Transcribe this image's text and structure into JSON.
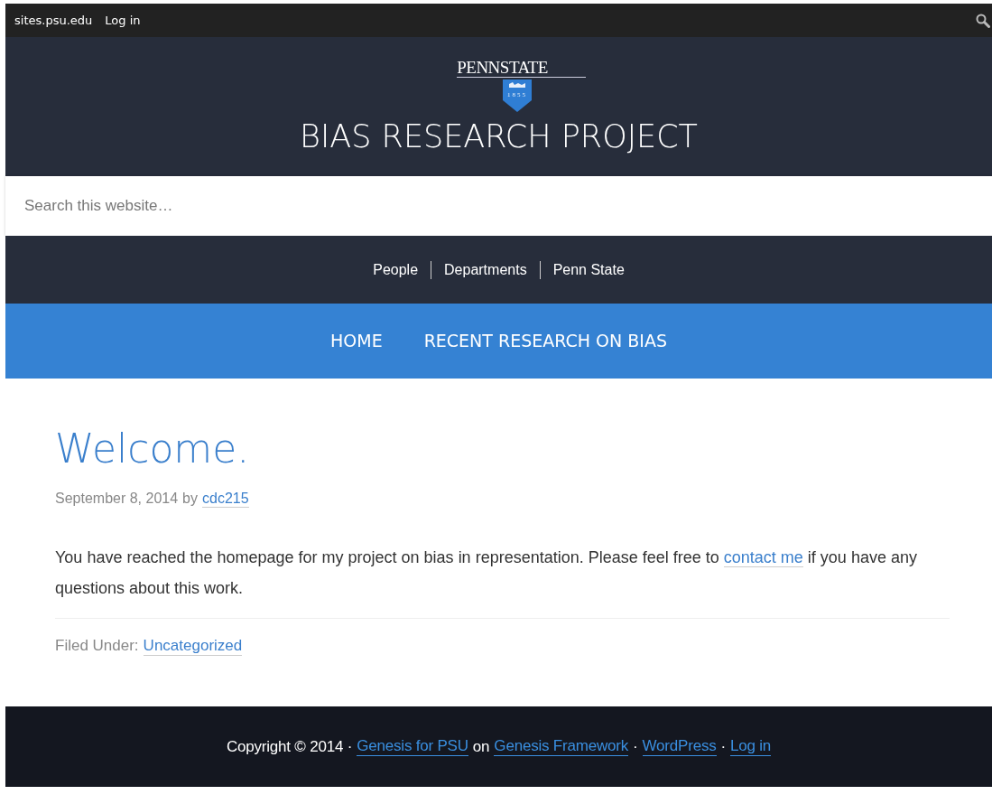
{
  "admin_bar": {
    "links": [
      "sites.psu.edu",
      "Log in"
    ]
  },
  "header": {
    "logo": {
      "wordmark": "PENNSTATE",
      "year": "1855"
    },
    "site_title": "BIAS RESEARCH PROJECT"
  },
  "search": {
    "placeholder": "Search this website…"
  },
  "utility_nav": [
    "People",
    "Departments",
    "Penn State"
  ],
  "main_nav": [
    {
      "label": "HOME",
      "selected": false
    },
    {
      "label": "RECENT RESEARCH ON BIAS",
      "selected": false
    }
  ],
  "post": {
    "title": "Welcome.",
    "date": "September 8, 2014",
    "by": "by",
    "author": "cdc215",
    "body": [
      {
        "kind": "text",
        "text": "You have reached the homepage for my project on bias in representation. Please feel free to "
      },
      {
        "kind": "link",
        "text": "contact me"
      },
      {
        "kind": "text",
        "text": " if you have any questions about this work."
      }
    ],
    "filed_label": "Filed Under:",
    "category": "Uncategorized"
  },
  "footer": [
    {
      "kind": "text",
      "text": "Copyright © 2014 ·"
    },
    {
      "kind": "link",
      "text": "Genesis for PSU"
    },
    {
      "kind": "text",
      "text": "on"
    },
    {
      "kind": "link",
      "text": "Genesis Framework"
    },
    {
      "kind": "text",
      "text": "·"
    },
    {
      "kind": "link",
      "text": "WordPress"
    },
    {
      "kind": "text",
      "text": "·"
    },
    {
      "kind": "link",
      "text": "Log in"
    }
  ]
}
